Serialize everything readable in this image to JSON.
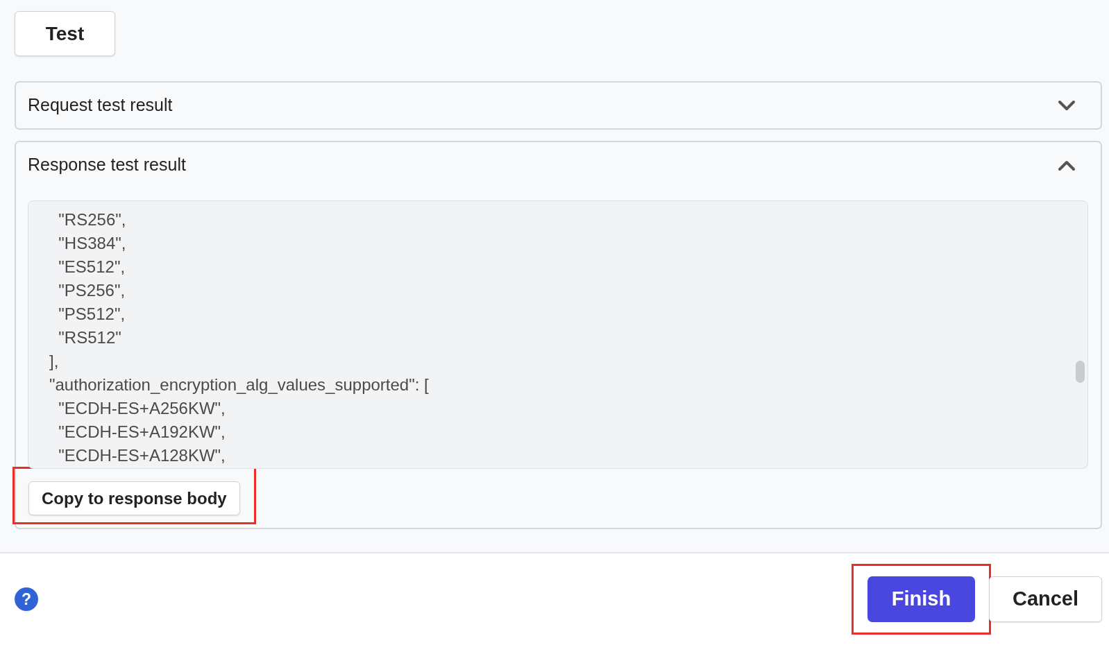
{
  "test_button": {
    "label": "Test"
  },
  "sections": [
    {
      "title": "Request test result",
      "expanded": false
    },
    {
      "title": "Response test result",
      "expanded": true,
      "code_lines": [
        "  \"RS256\",",
        "  \"HS384\",",
        "  \"ES512\",",
        "  \"PS256\",",
        "  \"PS512\",",
        "  \"RS512\"",
        "],",
        "\"authorization_encryption_alg_values_supported\": [",
        "  \"ECDH-ES+A256KW\",",
        "  \"ECDH-ES+A192KW\",",
        "  \"ECDH-ES+A128KW\","
      ],
      "copy_button": {
        "label": "Copy to response body",
        "highlighted": true
      }
    }
  ],
  "footer": {
    "help": "?",
    "buttons": [
      {
        "label": "Finish",
        "kind": "primary",
        "highlighted": true
      },
      {
        "label": "Cancel",
        "kind": "secondary",
        "highlighted": false
      }
    ]
  }
}
